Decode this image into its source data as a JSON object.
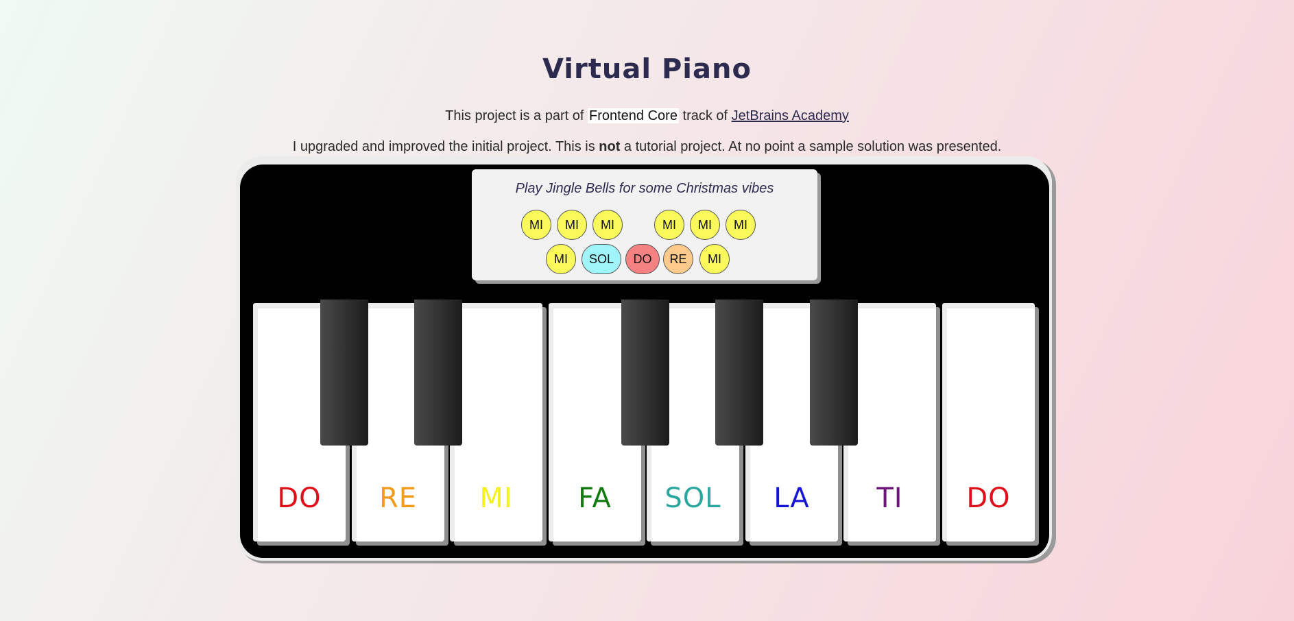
{
  "header": {
    "title": "Virtual Piano",
    "intro_prefix": "This project is a part of ",
    "intro_chip": "Frontend Core",
    "intro_middle": " track of ",
    "intro_link": "JetBrains Academy",
    "note_prefix": "I upgraded and improved the initial project. This is ",
    "note_bold": "not",
    "note_suffix": " a tutorial project. At no point a sample solution was presented."
  },
  "song_panel": {
    "hint": "Play Jingle Bells for some Christmas vibes",
    "row1": [
      {
        "label": "MI",
        "color": "#f9f95c"
      },
      {
        "label": "MI",
        "color": "#f9f95c"
      },
      {
        "label": "MI",
        "color": "#f9f95c"
      },
      {
        "label": "MI",
        "color": "#f9f95c"
      },
      {
        "label": "MI",
        "color": "#f9f95c"
      },
      {
        "label": "MI",
        "color": "#f9f95c"
      }
    ],
    "row2": [
      {
        "label": "MI",
        "color": "#f9f95c"
      },
      {
        "label": "SOL",
        "color": "#9ff5f9"
      },
      {
        "label": "DO",
        "color": "#f58282"
      },
      {
        "label": "RE",
        "color": "#fdca8c"
      },
      {
        "label": "MI",
        "color": "#f9f95c"
      }
    ]
  },
  "keys": {
    "white": [
      {
        "label": "DO",
        "color": "#e0101a"
      },
      {
        "label": "RE",
        "color": "#f29b18"
      },
      {
        "label": "MI",
        "color": "#f5f021"
      },
      {
        "label": "FA",
        "color": "#117a0f"
      },
      {
        "label": "SOL",
        "color": "#2aa8a0"
      },
      {
        "label": "LA",
        "color": "#1515d6"
      },
      {
        "label": "TI",
        "color": "#6c127a"
      },
      {
        "label": "DO",
        "color": "#e0101a"
      }
    ],
    "black_count": 5
  }
}
